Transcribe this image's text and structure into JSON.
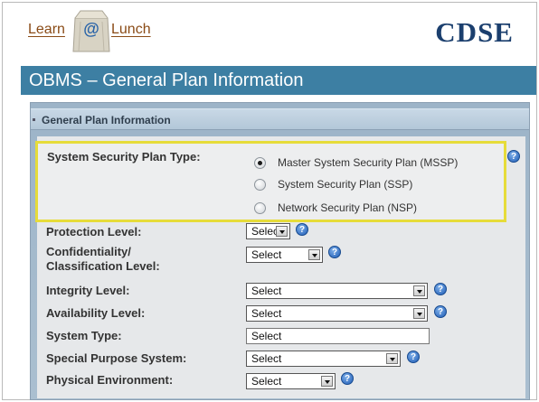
{
  "header": {
    "logo_left": "Learn",
    "logo_at": "@",
    "logo_right": "Lunch",
    "brand": "CDSE",
    "slide_title": "OBMS – General Plan Information"
  },
  "section": {
    "title": "General Plan Information"
  },
  "plan_type": {
    "label": "System Security Plan Type:",
    "options": [
      {
        "label": "Master System Security Plan (MSSP)",
        "selected": true
      },
      {
        "label": "System Security Plan (SSP)",
        "selected": false
      },
      {
        "label": "Network Security Plan (NSP)",
        "selected": false
      }
    ]
  },
  "fields": [
    {
      "label": "Protection Level:",
      "value": "Select"
    },
    {
      "label": "Confidentiality/",
      "label2": "Classification Level:",
      "value": "Select"
    },
    {
      "label": "Integrity Level:",
      "value": "Select"
    },
    {
      "label": "Availability Level:",
      "value": "Select"
    },
    {
      "label": "System Type:",
      "value": "Select"
    },
    {
      "label": "Special Purpose System:",
      "value": "Select"
    },
    {
      "label": "Physical Environment:",
      "value": "Select"
    }
  ],
  "help_glyph": "?",
  "colors": {
    "title_bar": "#3d7fa3",
    "highlight_border": "#e6dc3a",
    "brand": "#1b3f6e"
  }
}
